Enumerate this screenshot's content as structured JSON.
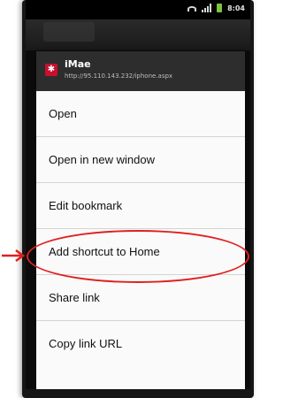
{
  "status": {
    "time": "8:04",
    "battery_color": "#7dc242"
  },
  "dialog": {
    "title": "iMae",
    "url": "http://95.110.143.232/iphone.aspx",
    "icon": "app-icon"
  },
  "menu": {
    "items": [
      {
        "label": "Open"
      },
      {
        "label": "Open in new window"
      },
      {
        "label": "Edit bookmark"
      },
      {
        "label": "Add shortcut to Home"
      },
      {
        "label": "Share link"
      },
      {
        "label": "Copy link URL"
      }
    ]
  },
  "annotation": {
    "highlight_color": "#e02020",
    "highlighted_item": "Add shortcut to Home"
  }
}
